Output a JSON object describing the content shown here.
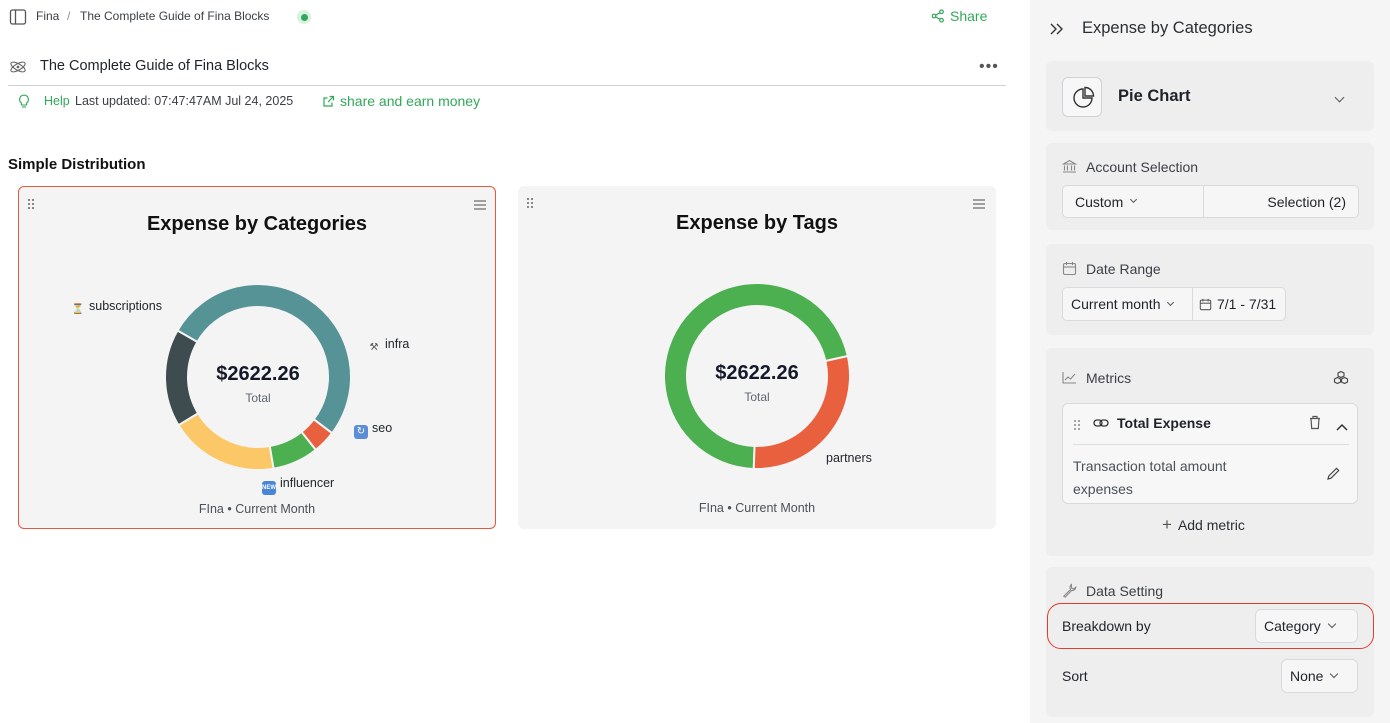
{
  "breadcrumb": {
    "workspace": "Fina",
    "separator": "/",
    "page": "The Complete Guide of Fina Blocks"
  },
  "header": {
    "share_label": "Share",
    "doc_title": "The Complete Guide of Fina Blocks",
    "help_label": "Help",
    "last_updated": "Last updated: 07:47:47AM Jul 24, 2025",
    "share_earn_label": "share and earn money"
  },
  "section": {
    "title": "Simple Distribution"
  },
  "cards": [
    {
      "title": "Expense by Categories",
      "center_value": "$2622.26",
      "center_label": "Total",
      "footer": "FIna • Current Month",
      "labels": {
        "subscriptions": "subscriptions",
        "infra": "infra",
        "seo": "seo",
        "influencer": "influencer"
      }
    },
    {
      "title": "Expense by Tags",
      "center_value": "$2622.26",
      "center_label": "Total",
      "footer": "FIna • Current Month",
      "labels": {
        "partners": "partners"
      }
    }
  ],
  "chart_data": [
    {
      "type": "pie",
      "title": "Expense by Categories",
      "categories": [
        "subscriptions",
        "",
        "infra",
        "seo",
        "influencer"
      ],
      "values": [
        52,
        4,
        8,
        19,
        17
      ],
      "colors": [
        "#559396",
        "#e8603e",
        "#4caf50",
        "#fcc767",
        "#3e4c50"
      ]
    },
    {
      "type": "pie",
      "title": "Expense by Tags",
      "categories": [
        "",
        "partners"
      ],
      "values": [
        71,
        29
      ],
      "colors": [
        "#4caf50",
        "#e8603e"
      ]
    }
  ],
  "panel": {
    "title": "Expense by Categories",
    "chart_type": "Pie Chart",
    "account_selection": {
      "label": "Account Selection",
      "mode": "Custom",
      "selection": "Selection (2)"
    },
    "date_range": {
      "label": "Date Range",
      "preset": "Current month",
      "range": "7/1 - 7/31"
    },
    "metrics": {
      "label": "Metrics",
      "item_title": "Total Expense",
      "item_description": "Transaction total amount expenses",
      "add_label": "Add metric"
    },
    "data_setting": {
      "label": "Data Setting",
      "breakdown_label": "Breakdown by",
      "breakdown_value": "Category",
      "sort_label": "Sort",
      "sort_value": "None"
    }
  },
  "colors": {
    "accent": "#31a85a",
    "highlight": "#e03d2c"
  }
}
